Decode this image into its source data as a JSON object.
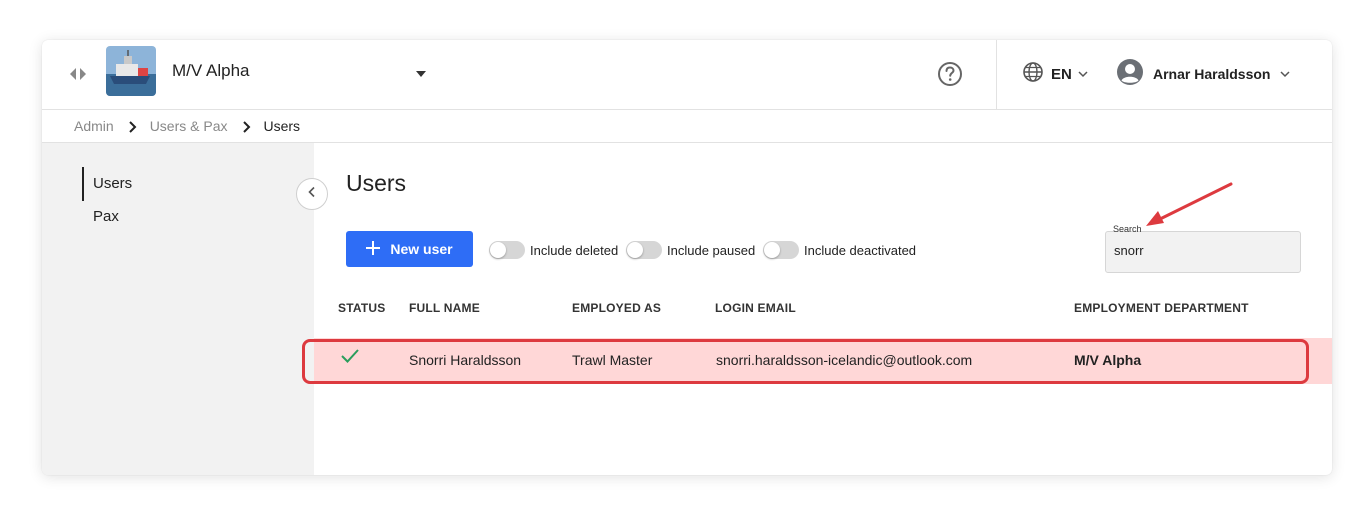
{
  "header": {
    "vessel_name": "M/V Alpha",
    "language": "EN",
    "user_name": "Arnar Haraldsson"
  },
  "breadcrumb": [
    "Admin",
    "Users & Pax",
    "Users"
  ],
  "sidebar": {
    "items": [
      {
        "label": "Users",
        "active": true
      },
      {
        "label": "Pax",
        "active": false
      }
    ]
  },
  "main": {
    "title": "Users",
    "new_user_label": "New user",
    "toggles": [
      {
        "label": "Include deleted",
        "on": false
      },
      {
        "label": "Include paused",
        "on": false
      },
      {
        "label": "Include deactivated",
        "on": false
      }
    ],
    "search": {
      "label": "Search",
      "value": "snorr"
    }
  },
  "table": {
    "columns": [
      "STATUS",
      "FULL NAME",
      "EMPLOYED AS",
      "LOGIN EMAIL",
      "EMPLOYMENT DEPARTMENT"
    ],
    "rows": [
      {
        "status": "active-check-icon",
        "full_name": "Snorri Haraldsson",
        "employed_as": "Trawl Master",
        "login_email": "snorri.haraldsson-icelandic@outlook.com",
        "department": "M/V Alpha"
      }
    ]
  },
  "colors": {
    "primary": "#2e6df6",
    "highlight_row": "#ffd7d7",
    "annotation_red": "#dd3a3f",
    "status_ok": "#2a9d5c"
  },
  "icons": [
    "nav-toggle-icon",
    "chevron-down-icon",
    "help-icon",
    "globe-icon",
    "user-avatar-icon",
    "chevron-right-icon",
    "chevron-left-icon",
    "plus-icon",
    "check-icon"
  ]
}
